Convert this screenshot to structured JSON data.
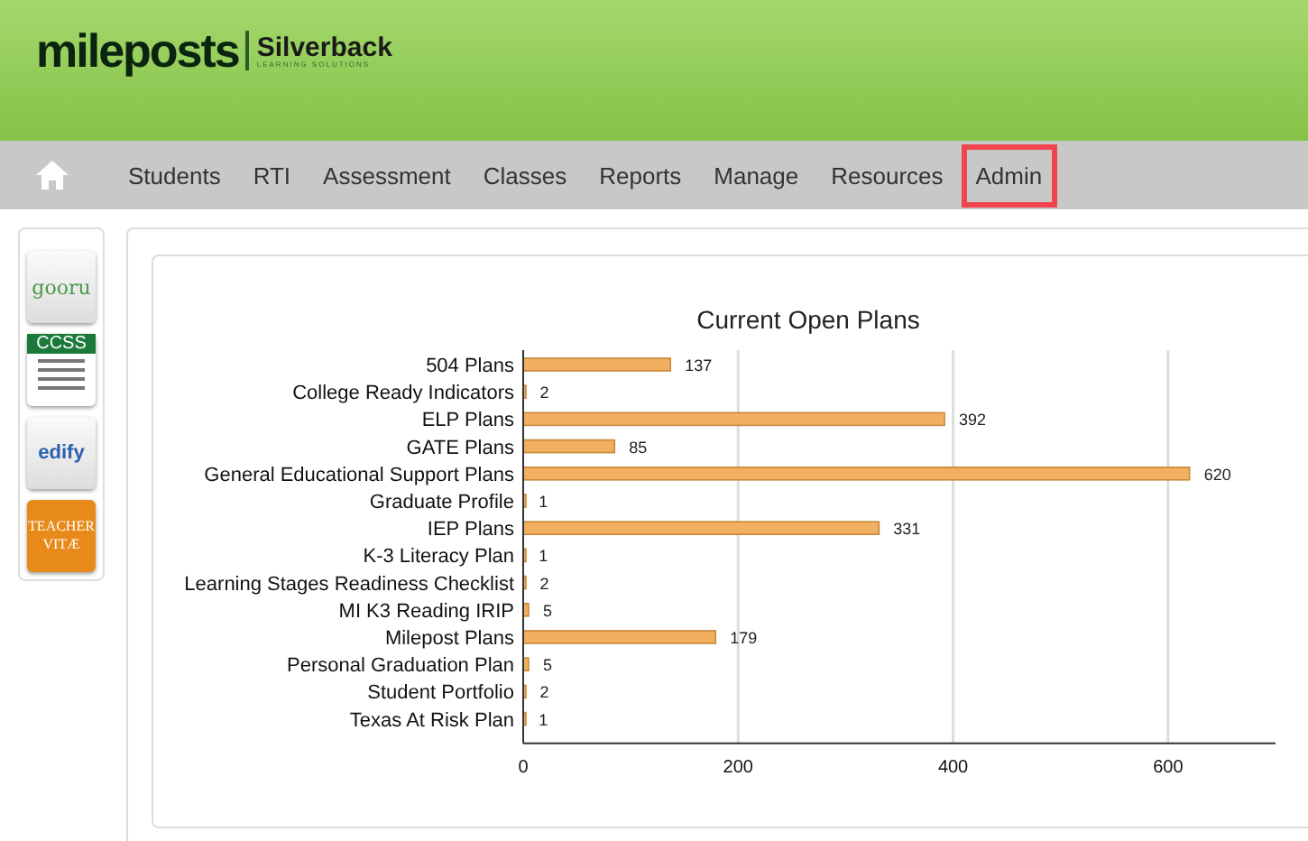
{
  "header": {
    "logo": {
      "brand": "mileposts",
      "partner": "Silverback",
      "tagline": "LEARNING SOLUTIONS"
    }
  },
  "nav": {
    "items": [
      {
        "label": "Students",
        "selected": false
      },
      {
        "label": "RTI",
        "selected": false
      },
      {
        "label": "Assessment",
        "selected": false
      },
      {
        "label": "Classes",
        "selected": false
      },
      {
        "label": "Reports",
        "selected": false
      },
      {
        "label": "Manage",
        "selected": false
      },
      {
        "label": "Resources",
        "selected": false
      },
      {
        "label": "Admin",
        "selected": true
      }
    ]
  },
  "sidebar": {
    "items": [
      {
        "kind": "gooru",
        "label": "gooru"
      },
      {
        "kind": "ccss",
        "label": "CCSS"
      },
      {
        "kind": "edify",
        "label": "edify"
      },
      {
        "kind": "vitae",
        "label": "TEACHER VITÆ"
      }
    ]
  },
  "chart": {
    "chart_data": {
      "type": "bar",
      "orientation": "horizontal",
      "title": "Current Open Plans",
      "categories": [
        "504 Plans",
        "College Ready Indicators",
        "ELP Plans",
        "GATE Plans",
        "General Educational Support Plans",
        "Graduate Profile",
        "IEP Plans",
        "K-3 Literacy Plan",
        "Learning Stages Readiness Checklist",
        "MI K3 Reading IRIP",
        "Milepost Plans",
        "Personal Graduation Plan",
        "Student Portfolio",
        "Texas At Risk Plan"
      ],
      "series": [
        {
          "color": "#f0b060",
          "values": [
            137,
            2,
            392,
            85,
            620,
            1,
            331,
            1,
            2,
            5,
            179,
            5,
            2,
            1
          ]
        }
      ],
      "xlim": [
        0,
        700
      ],
      "xticks": [
        0,
        200,
        400,
        600
      ],
      "grid": true,
      "data_labels": true
    }
  }
}
